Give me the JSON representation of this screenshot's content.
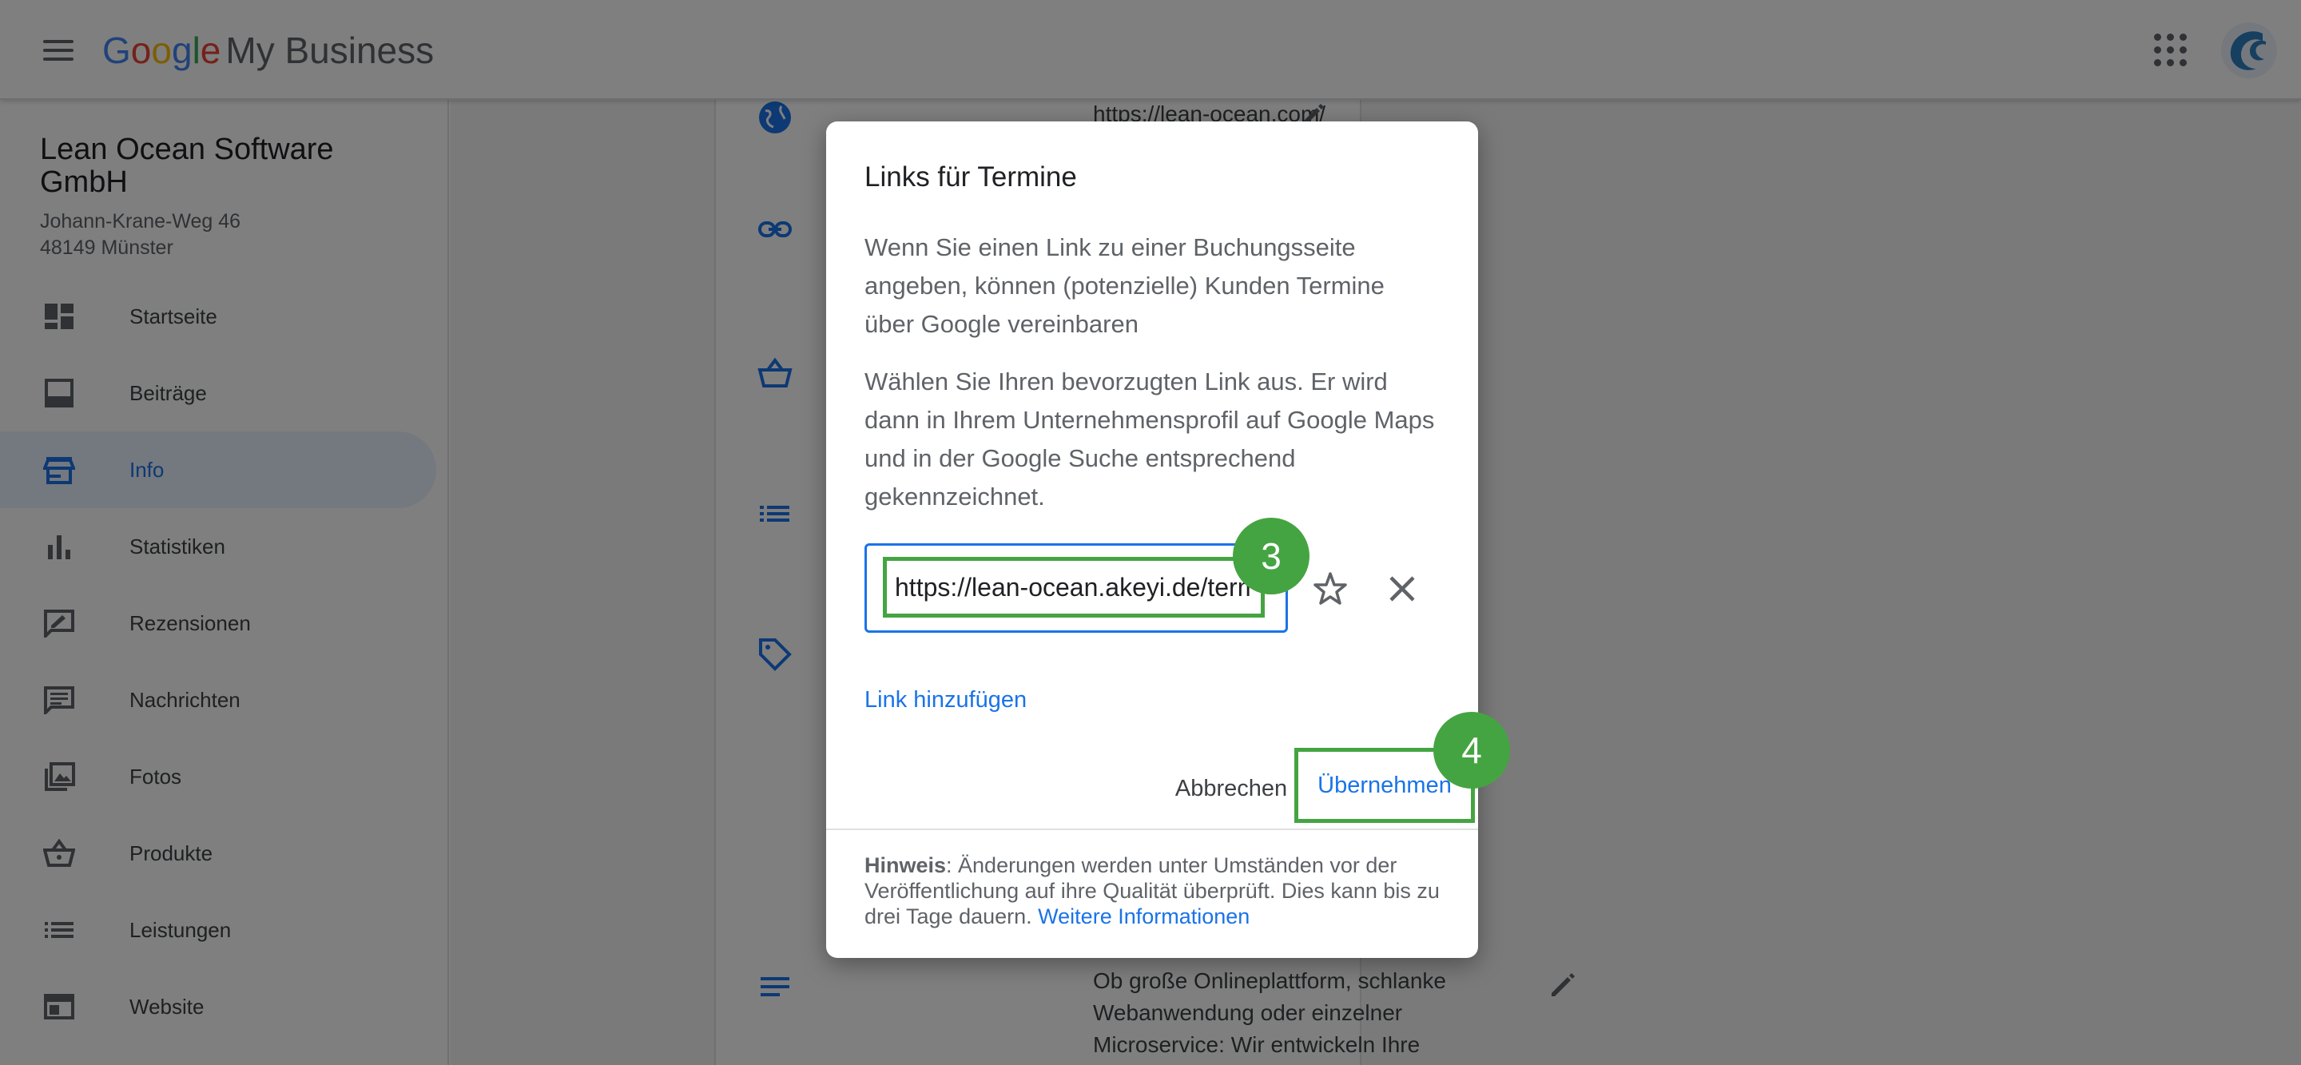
{
  "header": {
    "logo_letters": [
      "G",
      "o",
      "o",
      "g",
      "l",
      "e"
    ],
    "product": "My Business",
    "colors": {
      "blue": "#4285f4",
      "red": "#ea4335",
      "yellow": "#fbbc05",
      "green": "#34a853"
    }
  },
  "sidebar": {
    "business_name": "Lean Ocean Software GmbH",
    "address_line1": "Johann-Krane-Weg 46",
    "address_line2": "48149 Münster",
    "items": [
      {
        "label": "Startseite",
        "icon": "dashboard-icon"
      },
      {
        "label": "Beiträge",
        "icon": "posts-icon"
      },
      {
        "label": "Info",
        "icon": "storefront-icon",
        "active": true
      },
      {
        "label": "Statistiken",
        "icon": "bar-chart-icon"
      },
      {
        "label": "Rezensionen",
        "icon": "rate-review-icon"
      },
      {
        "label": "Nachrichten",
        "icon": "message-icon"
      },
      {
        "label": "Fotos",
        "icon": "photo-library-icon"
      },
      {
        "label": "Produkte",
        "icon": "basket-icon"
      },
      {
        "label": "Leistungen",
        "icon": "list-icon"
      },
      {
        "label": "Website",
        "icon": "web-icon"
      }
    ]
  },
  "card": {
    "website": "https://lean-ocean.com/",
    "description": "Ob große Onlineplattform, schlanke\nWebanwendung oder einzelner\nMicroservice: Wir entwickeln Ihre"
  },
  "dialog": {
    "title": "Links für Termine",
    "paragraph1": "Wenn Sie einen Link zu einer Buchungsseite angeben, können (potenzielle) Kunden Termine über Google vereinbaren",
    "paragraph2": "Wählen Sie Ihren bevorzugten Link aus. Er wird dann in Ihrem Unternehmensprofil auf Google Maps und in der Google Suche entsprechend gekennzeichnet.",
    "url_value": "https://lean-ocean.akeyi.de/termin",
    "add_link": "Link hinzufügen",
    "cancel": "Abbrechen",
    "apply": "Übernehmen",
    "note_label": "Hinweis",
    "note_text": ": Änderungen werden unter Umständen vor der Veröffentlichung auf ihre Qualität überprüft. Dies kann bis zu drei Tage dauern. ",
    "note_link": "Weitere Informationen"
  },
  "badges": {
    "step3": "3",
    "step4": "4"
  },
  "colors": {
    "accent": "#1a73e8",
    "highlight": "#45a442",
    "scrim": "rgba(0,0,0,0.5)"
  }
}
